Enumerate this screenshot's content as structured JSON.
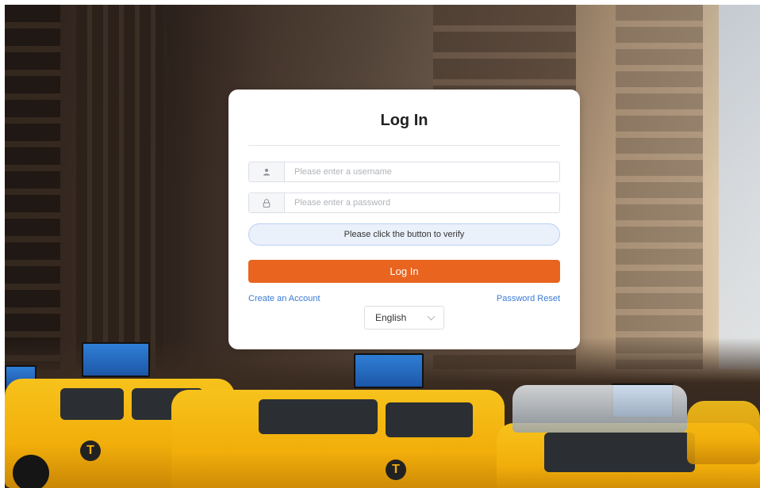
{
  "login": {
    "title": "Log In",
    "username": {
      "placeholder": "Please enter a username",
      "value": "",
      "icon": "user-icon"
    },
    "password": {
      "placeholder": "Please enter a password",
      "value": "",
      "icon": "lock-icon"
    },
    "verify_label": "Please click the button to verify",
    "submit_label": "Log In",
    "create_account_label": "Create an Account",
    "password_reset_label": "Password Reset",
    "language": {
      "selected": "English",
      "icon": "chevron-down-icon"
    }
  },
  "background": {
    "taxi_logo": "T"
  },
  "colors": {
    "accent": "#e8641f",
    "link": "#3a7bd5",
    "verify_bg": "#eaf1fb",
    "taxi_yellow": "#f2ae0a"
  }
}
